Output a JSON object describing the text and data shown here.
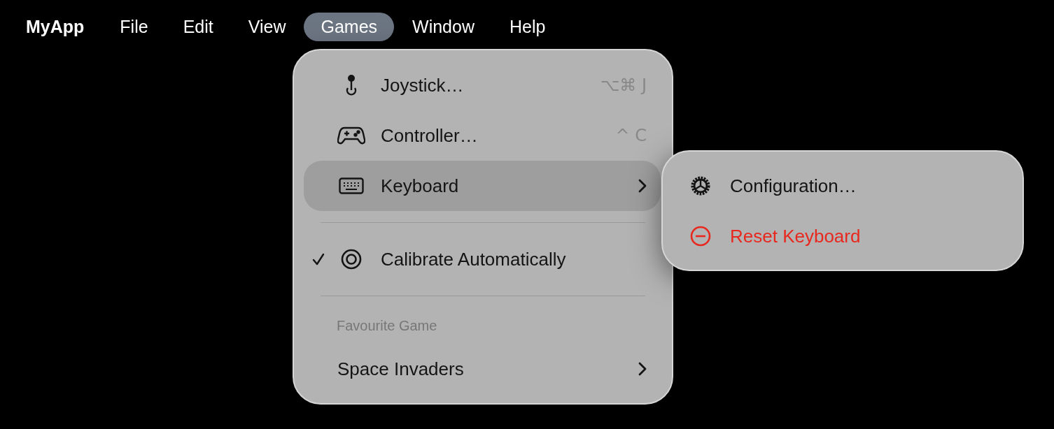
{
  "menu_bar": {
    "app_name": "MyApp",
    "items": [
      {
        "label": "File",
        "selected": false
      },
      {
        "label": "Edit",
        "selected": false
      },
      {
        "label": "View",
        "selected": false
      },
      {
        "label": "Games",
        "selected": true
      },
      {
        "label": "Window",
        "selected": false
      },
      {
        "label": "Help",
        "selected": false
      }
    ]
  },
  "menu": {
    "items": [
      {
        "kind": "item",
        "label": "Joystick…",
        "shortcut": "⌥⌘ J",
        "checked": false,
        "selected": false,
        "submenu": false
      },
      {
        "kind": "item",
        "label": "Controller…",
        "shortcut": "^ C",
        "checked": false,
        "selected": false,
        "submenu": false
      },
      {
        "kind": "item",
        "label": "Keyboard",
        "checked": false,
        "selected": true,
        "submenu": true
      },
      {
        "kind": "separator"
      },
      {
        "kind": "item",
        "label": "Calibrate Automatically",
        "checked": true,
        "selected": false,
        "submenu": false
      },
      {
        "kind": "separator"
      },
      {
        "kind": "header",
        "label": "Favourite Game"
      },
      {
        "kind": "item",
        "label": "Space Invaders",
        "checked": false,
        "selected": false,
        "submenu": true
      }
    ]
  },
  "submenu": {
    "items": [
      {
        "label": "Configuration…",
        "destructive": false
      },
      {
        "label": "Reset Keyboard",
        "destructive": true
      }
    ]
  }
}
